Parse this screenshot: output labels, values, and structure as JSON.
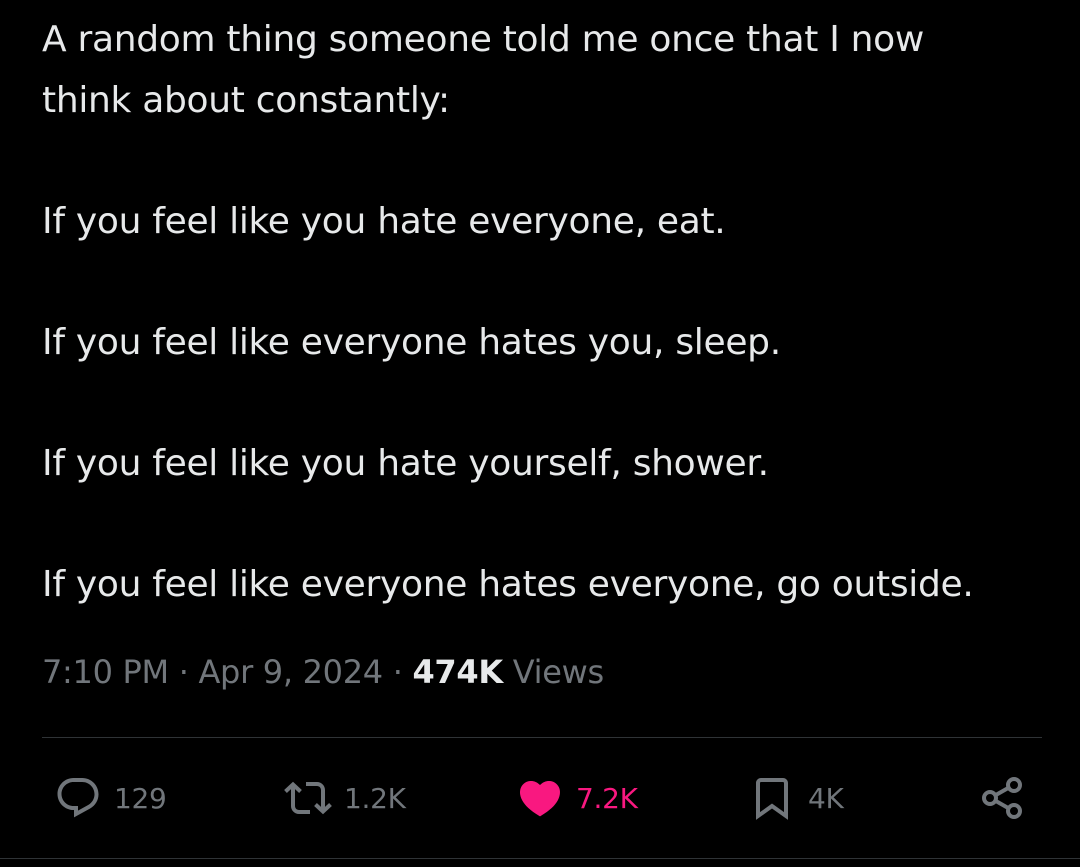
{
  "tweet": {
    "lines": [
      "A random thing someone told me once that I now",
      "think about constantly:",
      "If you feel like you hate everyone, eat.",
      "If you feel like everyone hates you, sleep.",
      "If you feel like you hate yourself, shower.",
      "If you feel like everyone hates everyone, go outside."
    ]
  },
  "meta": {
    "time": "7:10 PM",
    "separator": "·",
    "date": "Apr 9, 2024",
    "views_count": "474K",
    "views_label": "Views"
  },
  "actions": {
    "reply": {
      "icon": "reply-icon",
      "count": "129"
    },
    "retweet": {
      "icon": "retweet-icon",
      "count": "1.2K"
    },
    "like": {
      "icon": "heart-icon",
      "count": "7.2K",
      "active_color": "#f91880"
    },
    "bookmark": {
      "icon": "bookmark-icon",
      "count": "4K"
    },
    "share": {
      "icon": "share-icon"
    }
  },
  "colors": {
    "background": "#000000",
    "text": "#e7e9ea",
    "muted": "#71767b",
    "divider": "#2f3336",
    "like": "#f91880"
  }
}
